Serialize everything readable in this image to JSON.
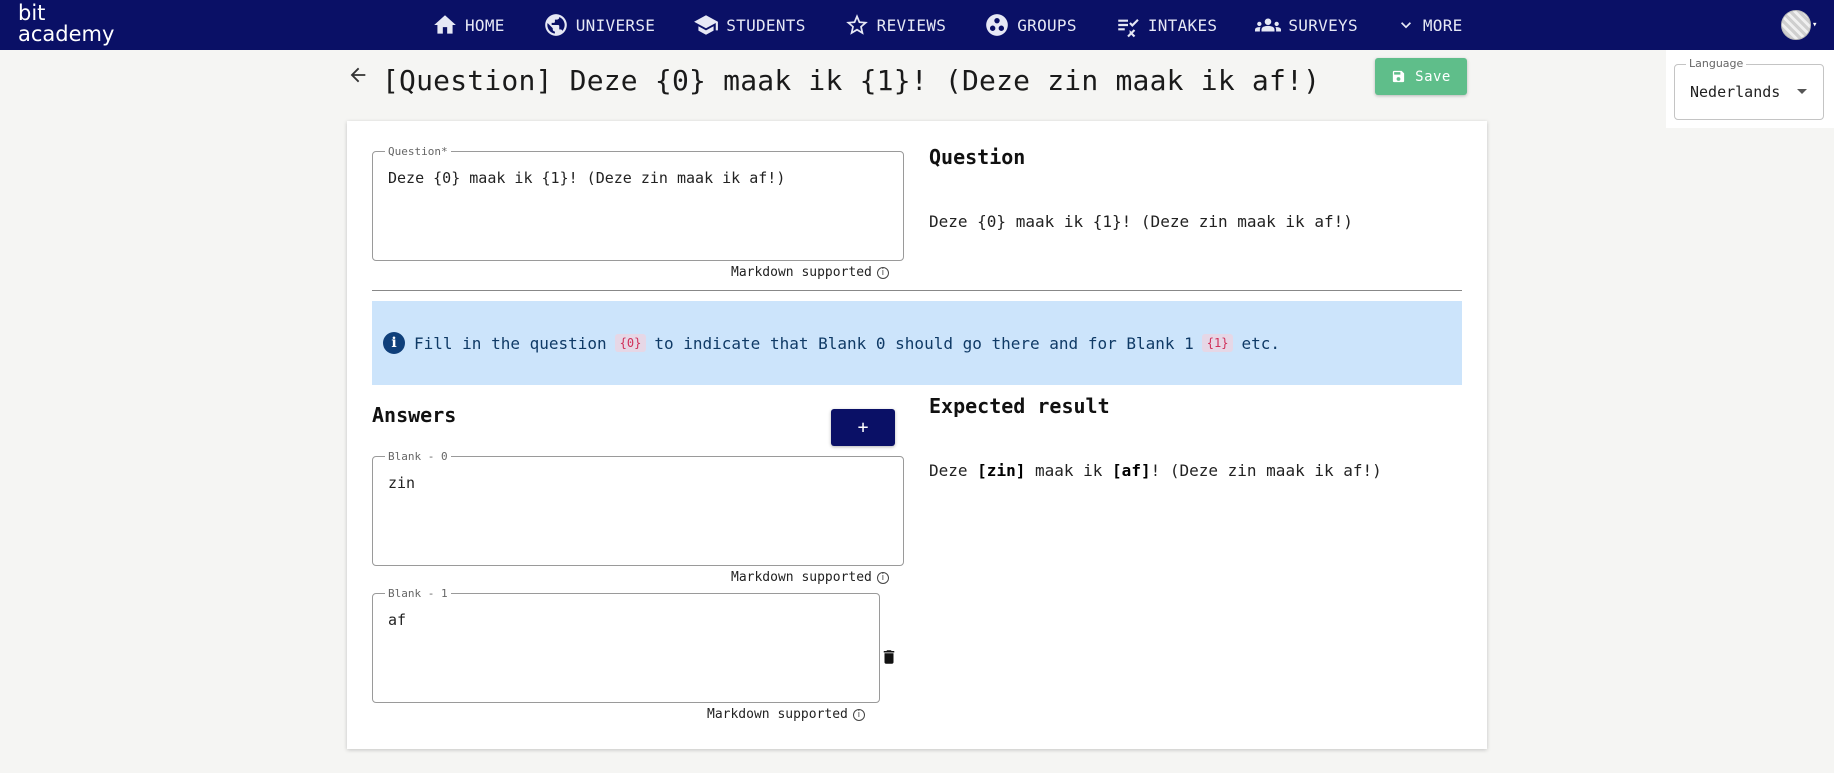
{
  "brand": {
    "line1": "bit",
    "line2": "academy"
  },
  "nav": [
    {
      "label": "HOME",
      "icon": "home-icon"
    },
    {
      "label": "UNIVERSE",
      "icon": "globe-icon"
    },
    {
      "label": "STUDENTS",
      "icon": "graduation-cap-icon"
    },
    {
      "label": "REVIEWS",
      "icon": "star-icon"
    },
    {
      "label": "GROUPS",
      "icon": "groups-icon"
    },
    {
      "label": "INTAKES",
      "icon": "checklist-icon"
    },
    {
      "label": "SURVEYS",
      "icon": "people-icon"
    },
    {
      "label": "MORE",
      "icon": "chevron-down-icon"
    }
  ],
  "header": {
    "title": "[Question] Deze {0} maak ik {1}! (Deze zin maak ik af!)",
    "save_label": "Save"
  },
  "language": {
    "legend": "Language",
    "value": "Nederlands"
  },
  "question_field": {
    "legend": "Question*",
    "value": "Deze {0} maak ik {1}! (Deze zin maak ik af!)",
    "markdown_note": "Markdown supported"
  },
  "question_preview": {
    "heading": "Question",
    "text": "Deze {0} maak ik {1}! (Deze zin maak ik af!)"
  },
  "info_alert": {
    "part1": "Fill in the question",
    "code1": "{0}",
    "part2": "to indicate that Blank 0 should go there and for Blank 1",
    "code2": "{1}",
    "part3": "etc."
  },
  "answers": {
    "heading": "Answers",
    "add_label": "+",
    "blanks": [
      {
        "legend": "Blank - 0",
        "value": "zin",
        "markdown_note": "Markdown supported"
      },
      {
        "legend": "Blank - 1",
        "value": "af",
        "markdown_note": "Markdown supported"
      }
    ]
  },
  "expected": {
    "heading": "Expected result",
    "pre": "Deze ",
    "blank0": "[zin]",
    "mid": " maak ik ",
    "blank1": "[af]",
    "post": "! (Deze zin maak ik af!)"
  },
  "colors": {
    "nav_bg": "#0a1066",
    "save_bg": "#5fbe8a",
    "alert_bg": "#cce4fb",
    "code_color": "#d0305a"
  }
}
